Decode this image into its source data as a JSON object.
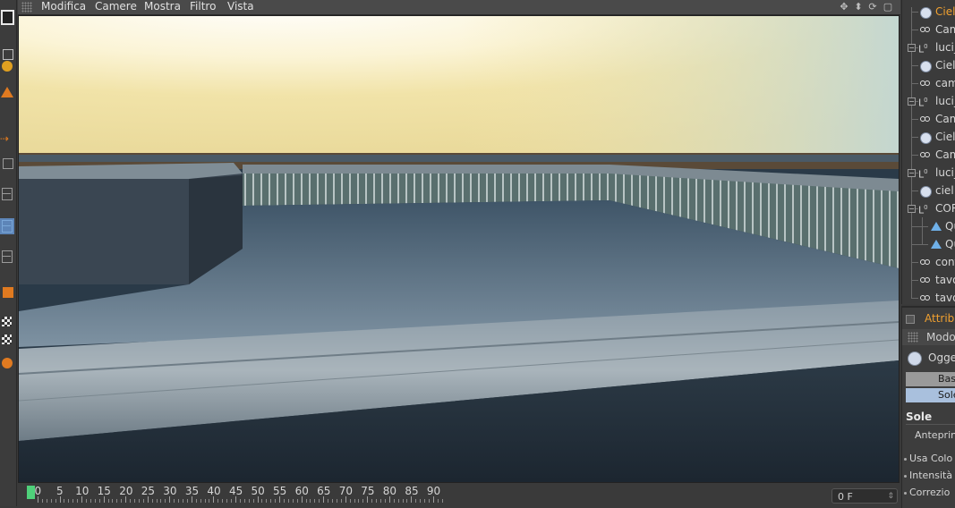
{
  "menu": {
    "items": [
      "Modifica",
      "Camere",
      "Mostra",
      "Filtro",
      "Vista"
    ]
  },
  "view_controls": [
    "move-icon",
    "dolly-icon",
    "rotate-icon",
    "maximize-icon"
  ],
  "left_toolbar": {
    "tools": [
      "view-panel-icon",
      "knife-tool-icon",
      "sphere-grid-icon",
      "cone-tool-icon",
      "arrow-icon",
      "move-handle-icon",
      "layout-icon",
      "layout-selected-icon",
      "layout-alt-icon",
      "layer-icon",
      "checker-icon",
      "checker-small-icon",
      "primitive-icon"
    ]
  },
  "timeline": {
    "labels": [
      "0",
      "5",
      "10",
      "15",
      "20",
      "25",
      "30",
      "35",
      "40",
      "45",
      "50",
      "55",
      "60",
      "65",
      "70",
      "75",
      "80",
      "85",
      "90"
    ],
    "current_frame": "0 F"
  },
  "object_manager": {
    "rows": [
      {
        "label": "Ciel",
        "icon": "sky-icon",
        "selected": true
      },
      {
        "label": "Cam",
        "icon": "camera-icon"
      },
      {
        "label": "luci_",
        "icon": "null-icon",
        "expandable": true
      },
      {
        "label": "Ciel",
        "icon": "sky-icon"
      },
      {
        "label": "cam",
        "icon": "camera-icon"
      },
      {
        "label": "luci_",
        "icon": "null-icon",
        "expandable": true
      },
      {
        "label": "Cam",
        "icon": "camera-icon"
      },
      {
        "label": "Ciel",
        "icon": "sky-icon"
      },
      {
        "label": "Cam",
        "icon": "camera-icon"
      },
      {
        "label": "luci_",
        "icon": "null-icon",
        "expandable": true
      },
      {
        "label": "ciel",
        "icon": "sky-icon"
      },
      {
        "label": "COR",
        "icon": "null-icon",
        "expandable": true
      },
      {
        "label": "Qu",
        "icon": "light-icon",
        "child": true
      },
      {
        "label": "Qu",
        "icon": "light-icon",
        "child": true
      },
      {
        "label": "cont",
        "icon": "camera-icon"
      },
      {
        "label": "tavo",
        "icon": "camera-icon"
      },
      {
        "label": "tavo",
        "icon": "camera-icon"
      }
    ]
  },
  "attributes": {
    "title": "Attribu",
    "mode": "Modo",
    "object": "Ogget",
    "tabs": [
      "Base",
      "Sole"
    ],
    "section": "Sole",
    "fields": [
      "Anteprin",
      "Usa Colo",
      "Intensità",
      "Correzio"
    ]
  },
  "colors": {
    "accent": "#f0a030",
    "playhead": "#4fd07a",
    "selected_tab": "#a9c0dd"
  }
}
